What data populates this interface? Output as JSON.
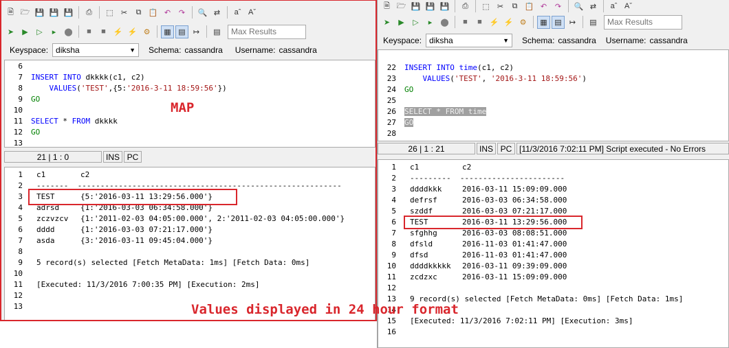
{
  "left": {
    "max_results_placeholder": "Max Results",
    "keyspace_label": "Keyspace:",
    "keyspace_value": "diksha",
    "schema_label": "Schema:",
    "schema_value": "cassandra",
    "username_label": "Username:",
    "username_value": "cassandra",
    "editor_lines": [
      {
        "n": "6",
        "parts": []
      },
      {
        "n": "7",
        "parts": [
          {
            "t": "INSERT INTO",
            "c": "kw"
          },
          {
            "t": " dkkkk(c1, c2)",
            "c": ""
          }
        ]
      },
      {
        "n": "8",
        "parts": [
          {
            "t": "    VALUES",
            "c": "kw"
          },
          {
            "t": "(",
            "c": ""
          },
          {
            "t": "'TEST'",
            "c": "str"
          },
          {
            "t": ",{5:",
            "c": ""
          },
          {
            "t": "'2016-3-11 18:59:56'",
            "c": "str"
          },
          {
            "t": "})",
            "c": ""
          }
        ]
      },
      {
        "n": "9",
        "parts": [
          {
            "t": "GO",
            "c": "go"
          }
        ]
      },
      {
        "n": "10",
        "parts": []
      },
      {
        "n": "11",
        "parts": [
          {
            "t": "SELECT",
            "c": "kw"
          },
          {
            "t": " * ",
            "c": ""
          },
          {
            "t": "FROM",
            "c": "kw"
          },
          {
            "t": " dkkkk",
            "c": ""
          }
        ]
      },
      {
        "n": "12",
        "parts": [
          {
            "t": "GO",
            "c": "go"
          }
        ]
      },
      {
        "n": "13",
        "parts": []
      }
    ],
    "status": {
      "position": "21 | 1 : 0",
      "mode": "INS",
      "enc": "PC"
    },
    "results": {
      "header": {
        "c1": "c1",
        "c2": "c2"
      },
      "separator": "-------  ----------------------------------------------------------",
      "rows": [
        {
          "c1": "TEST",
          "c2": "{5:'2016-03-11 13:29:56.000'}"
        },
        {
          "c1": "adrsd",
          "c2": "{1:'2016-03-03 06:34:58.000'}"
        },
        {
          "c1": "zczvzcv",
          "c2": "{1:'2011-02-03 04:05:00.000', 2:'2011-02-03 04:05:00.000'}"
        },
        {
          "c1": "dddd",
          "c2": "{1:'2016-03-03 07:21:17.000'}"
        },
        {
          "c1": "asda",
          "c2": "{3:'2016-03-11 09:45:04.000'}"
        }
      ],
      "summary": "5 record(s) selected [Fetch MetaData: 1ms] [Fetch Data: 0ms]",
      "executed": "[Executed: 11/3/2016 7:00:35 PM] [Execution: 2ms]",
      "line_numbers": [
        "1",
        "2",
        "3",
        "4",
        "5",
        "6",
        "7",
        "8",
        "9",
        "10",
        "11",
        "12",
        "13"
      ]
    }
  },
  "right": {
    "max_results_placeholder": "Max Results",
    "keyspace_label": "Keyspace:",
    "keyspace_value": "diksha",
    "schema_label": "Schema:",
    "schema_value": "cassandra",
    "username_label": "Username:",
    "username_value": "cassandra",
    "editor_lines": [
      {
        "n": "",
        "parts": []
      },
      {
        "n": "22",
        "parts": [
          {
            "t": "INSERT INTO",
            "c": "kw"
          },
          {
            "t": " ",
            "c": ""
          },
          {
            "t": "time",
            "c": "kw"
          },
          {
            "t": "(c1, c2)",
            "c": ""
          }
        ]
      },
      {
        "n": "23",
        "parts": [
          {
            "t": "    VALUES",
            "c": "kw"
          },
          {
            "t": "(",
            "c": ""
          },
          {
            "t": "'TEST'",
            "c": "str"
          },
          {
            "t": ", ",
            "c": ""
          },
          {
            "t": "'2016-3-11 18:59:56'",
            "c": "str"
          },
          {
            "t": ")",
            "c": ""
          }
        ]
      },
      {
        "n": "24",
        "parts": [
          {
            "t": "GO",
            "c": "go"
          }
        ]
      },
      {
        "n": "25",
        "parts": []
      },
      {
        "n": "26",
        "parts": [
          {
            "t": "SELECT * FROM time",
            "c": "sel"
          }
        ],
        "selected": true
      },
      {
        "n": "27",
        "parts": [
          {
            "t": "GO",
            "c": "sel"
          }
        ],
        "selected": false
      },
      {
        "n": "28",
        "parts": []
      }
    ],
    "status": {
      "position": "26 | 1 : 21",
      "mode": "INS",
      "enc": "PC",
      "message": "[11/3/2016 7:02:11 PM] Script executed - No Errors"
    },
    "results": {
      "header": {
        "c1": "c1",
        "c2": "c2"
      },
      "separator": "---------  -----------------------",
      "rows": [
        {
          "c1": "ddddkkk",
          "c2": "2016-03-11 15:09:09.000"
        },
        {
          "c1": "defrsf",
          "c2": "2016-03-03 06:34:58.000"
        },
        {
          "c1": "szddf",
          "c2": "2016-03-03 07:21:17.000"
        },
        {
          "c1": "TEST",
          "c2": "2016-03-11 13:29:56.000"
        },
        {
          "c1": "sfghhg",
          "c2": "2016-03-03 08:08:51.000"
        },
        {
          "c1": "dfsld",
          "c2": "2016-11-03 01:41:47.000"
        },
        {
          "c1": "dfsd",
          "c2": "2016-11-03 01:41:47.000"
        },
        {
          "c1": "ddddkkkkk",
          "c2": "2016-03-11 09:39:09.000"
        },
        {
          "c1": "zcdzxc",
          "c2": "2016-03-11 15:09:09.000"
        }
      ],
      "summary": "9 record(s) selected [Fetch MetaData: 0ms] [Fetch Data: 1ms]",
      "executed": "[Executed: 11/3/2016 7:02:11 PM] [Execution: 3ms]",
      "line_numbers": [
        "1",
        "2",
        "3",
        "4",
        "5",
        "6",
        "7",
        "8",
        "9",
        "10",
        "11",
        "12",
        "13",
        "14",
        "15",
        "16"
      ]
    }
  },
  "annotations": {
    "map_label": "MAP",
    "format_label": "Values displayed in 24 hour format",
    "color": "#d9262c"
  },
  "toolbar_icons_row1": [
    "new-file-icon",
    "open-folder-icon",
    "save-icon",
    "save-all-icon",
    "save-as-icon",
    "print-icon",
    "select-icon",
    "cut-icon",
    "copy-icon",
    "paste-icon",
    "undo-icon",
    "redo-icon",
    "find-icon",
    "replace-icon",
    "font-increase-icon",
    "font-decrease-icon"
  ],
  "toolbar_icons_row2": [
    "run-all-icon",
    "run-icon",
    "run-current-icon",
    "run-selection-icon",
    "stop-icon",
    "commit-icon",
    "rollback-icon",
    "connect-icon",
    "disconnect-icon",
    "options-icon",
    "grid-view-icon",
    "text-view-icon",
    "export-icon",
    "limit-icon"
  ]
}
